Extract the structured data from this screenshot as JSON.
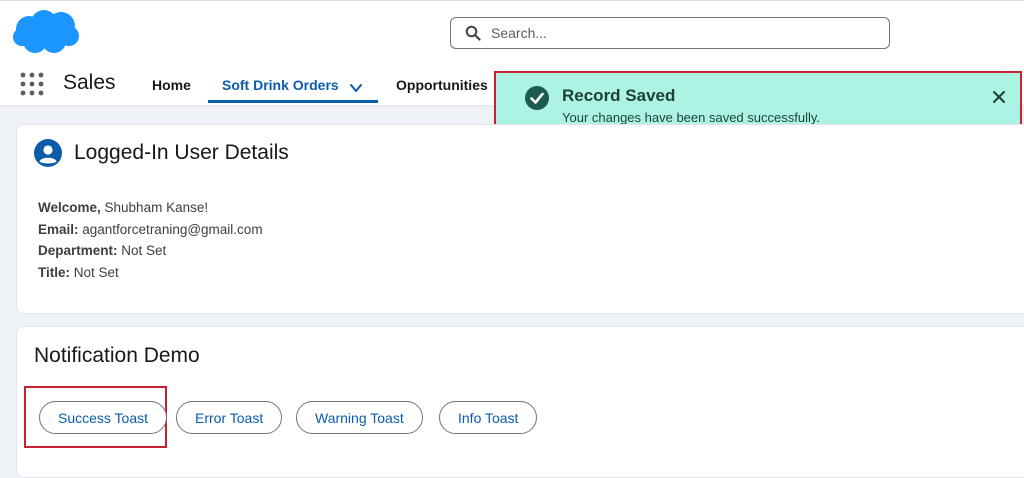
{
  "header": {
    "app_name": "Sales",
    "search_placeholder": "Search...",
    "nav_tabs": [
      {
        "label": "Home"
      },
      {
        "label": "Soft Drink Orders"
      },
      {
        "label": "Opportunities"
      }
    ],
    "logo_icon": "salesforce-cloud-icon",
    "brand_color": "#1b96ff",
    "accent_color": "#0b5cab"
  },
  "toast": {
    "title": "Record Saved",
    "message": "Your changes have been saved successfully.",
    "background": "#acf3e4",
    "icon": "check-circle-icon"
  },
  "user_card": {
    "title": "Logged-In User Details",
    "welcome_label": "Welcome,",
    "welcome_value": " Shubham Kanse!",
    "email_label": "Email:",
    "email_value": " agantforcetraning@gmail.com",
    "department_label": "Department:",
    "department_value": " Not Set",
    "title_label": "Title:",
    "title_value": " Not Set"
  },
  "notification_card": {
    "title": "Notification Demo",
    "buttons": [
      {
        "label": "Success Toast"
      },
      {
        "label": "Error Toast"
      },
      {
        "label": "Warning Toast"
      },
      {
        "label": "Info Toast"
      }
    ]
  }
}
